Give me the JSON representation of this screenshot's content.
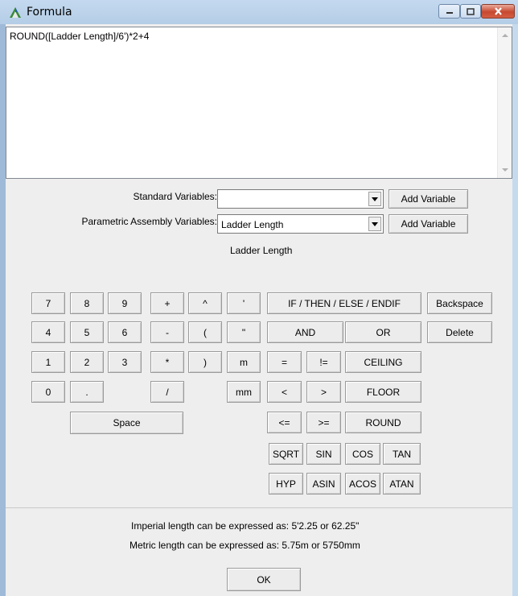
{
  "window": {
    "title": "Formula"
  },
  "formula": {
    "text": "ROUND([Ladder Length]/6')*2+4"
  },
  "standard_vars": {
    "label": "Standard Variables:",
    "value": "",
    "add": "Add Variable"
  },
  "param_vars": {
    "label": "Parametric Assembly Variables:",
    "value": "Ladder Length",
    "add": "Add Variable",
    "selected_display": "Ladder Length"
  },
  "keys": {
    "k7": "7",
    "k8": "8",
    "k9": "9",
    "k4": "4",
    "k5": "5",
    "k6": "6",
    "k1": "1",
    "k2": "2",
    "k3": "3",
    "k0": "0",
    "dot": ".",
    "plus": "+",
    "caret": "^",
    "apos": "'",
    "minus": "-",
    "lparen": "(",
    "quote": "\"",
    "mult": "*",
    "rparen": ")",
    "m": "m",
    "div": "/",
    "mm": "mm",
    "space": "Space",
    "ifthen": "IF / THEN / ELSE / ENDIF",
    "and": "AND",
    "or": "OR",
    "eq": "=",
    "neq": "!=",
    "ceiling": "CEILING",
    "lt": "<",
    "gt": ">",
    "floor": "FLOOR",
    "le": "<=",
    "ge": ">=",
    "round": "ROUND",
    "sqrt": "SQRT",
    "sin": "SIN",
    "cos": "COS",
    "tan": "TAN",
    "hyp": "HYP",
    "asin": "ASIN",
    "acos": "ACOS",
    "atan": "ATAN",
    "backspace": "Backspace",
    "delete": "Delete"
  },
  "info": {
    "imperial": "Imperial length can be expressed as:  5'2.25 or 62.25\"",
    "metric": "Metric length can be expressed as:  5.75m or 5750mm"
  },
  "ok": "OK",
  "colors": {
    "titlebar": "#b9d1ea",
    "client": "#eeeeee",
    "close": "#c7482f"
  }
}
